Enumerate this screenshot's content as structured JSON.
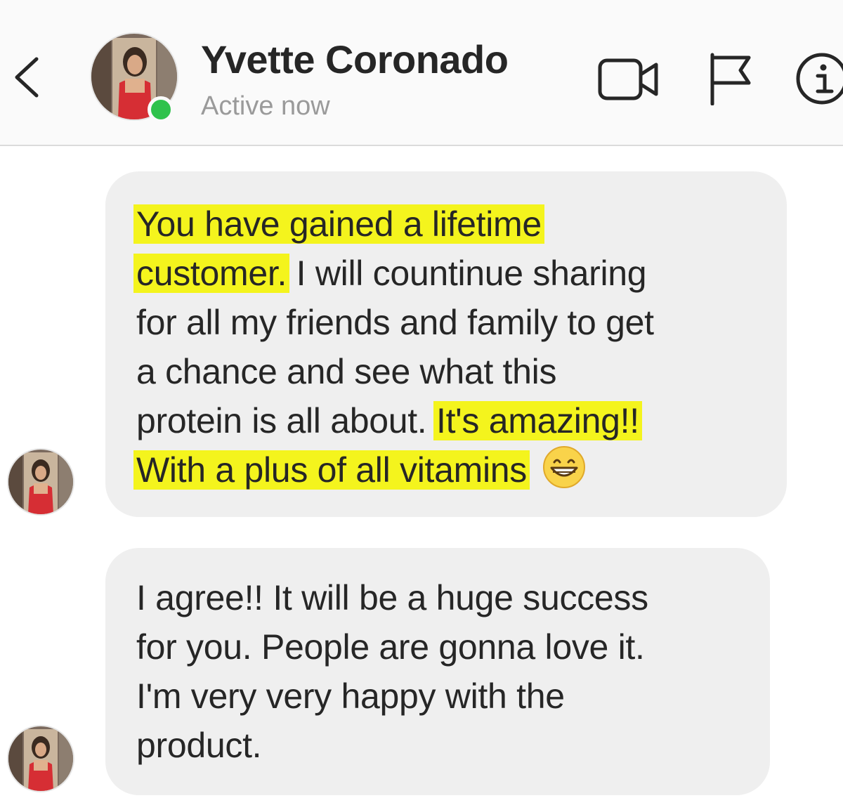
{
  "header": {
    "contact_name": "Yvette Coronado",
    "status": "Active now",
    "status_color": "#2fc24c",
    "back_icon": "chevron-left-icon",
    "actions": [
      "video-call-icon",
      "flag-icon",
      "info-icon"
    ]
  },
  "messages": [
    {
      "sender": "Yvette Coronado",
      "lines": [
        {
          "segments": [
            {
              "text": "You have gained a lifetime",
              "highlight": true
            }
          ]
        },
        {
          "segments": [
            {
              "text": "customer.",
              "highlight": true
            },
            {
              "text": " I will countinue sharing",
              "highlight": false
            }
          ]
        },
        {
          "segments": [
            {
              "text": "for all my friends and family to get",
              "highlight": false
            }
          ]
        },
        {
          "segments": [
            {
              "text": "a chance and see what this",
              "highlight": false
            }
          ]
        },
        {
          "segments": [
            {
              "text": "protein is all about. ",
              "highlight": false
            },
            {
              "text": "It's amazing!!",
              "highlight": true
            }
          ]
        },
        {
          "segments": [
            {
              "text": "With a plus of all vitamins",
              "highlight": true
            }
          ],
          "emoji": "grinning-face-emoji"
        }
      ]
    },
    {
      "sender": "Yvette Coronado",
      "lines": [
        {
          "segments": [
            {
              "text": "I agree!! It will be a huge success",
              "highlight": false
            }
          ]
        },
        {
          "segments": [
            {
              "text": "for you. People are gonna love it.",
              "highlight": false
            }
          ]
        },
        {
          "segments": [
            {
              "text": "I'm very very happy with the",
              "highlight": false
            }
          ]
        },
        {
          "segments": [
            {
              "text": "product.",
              "highlight": false
            }
          ]
        }
      ]
    }
  ],
  "colors": {
    "highlight": "#f4f41d",
    "bubble": "#efefef",
    "text": "#262626",
    "status_text": "#9a9a9a"
  }
}
